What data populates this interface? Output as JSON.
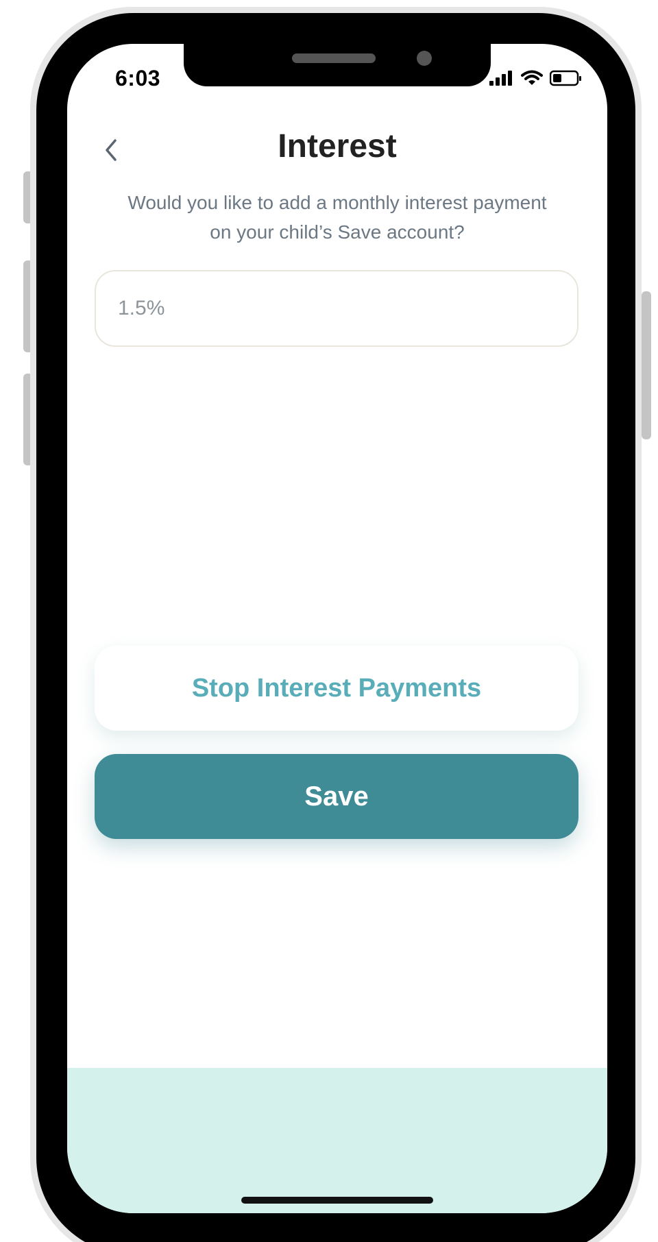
{
  "status_bar": {
    "time": "6:03",
    "icons": [
      "signal-icon",
      "wifi-icon",
      "battery-icon"
    ]
  },
  "header": {
    "back_icon": "chevron-left-icon",
    "title": "Interest"
  },
  "main": {
    "subtitle": "Would you like to add a monthly interest payment on your child’s Save account?",
    "interest_input": {
      "placeholder": "1.5%",
      "value": ""
    },
    "stop_button_label": "Stop Interest Payments",
    "save_button_label": "Save"
  },
  "colors": {
    "primary": "#3f8b96",
    "accent_text": "#58adb9",
    "bottom_panel": "#d4f1ec",
    "subtitle_text": "#6b7883"
  }
}
